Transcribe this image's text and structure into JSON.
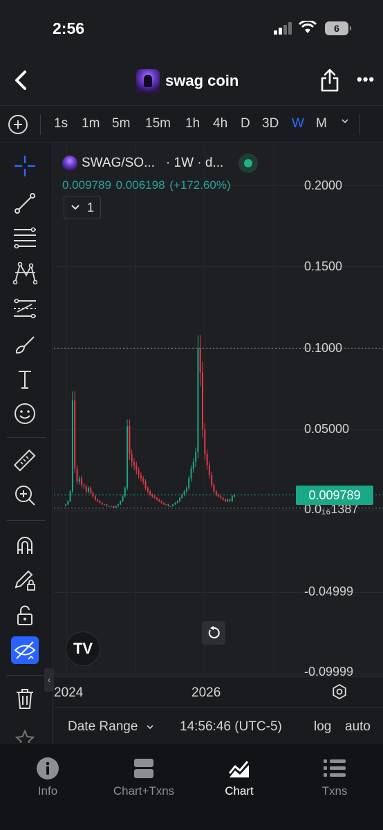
{
  "status_bar": {
    "time": "2:56",
    "battery": "6"
  },
  "header": {
    "title": "swag coin"
  },
  "timeframes": {
    "items": [
      "1s",
      "1m",
      "5m",
      "15m",
      "1h",
      "4h",
      "D",
      "3D",
      "W",
      "M"
    ],
    "selected": "W"
  },
  "chart": {
    "symbol": "SWAG/SO...",
    "interval": "· 1W · d...",
    "ohlc_text": "0.009789  0.006198 (+172.60%)",
    "collapse_count": "1",
    "price_labels": [
      "0.2000",
      "0.1500",
      "0.1000",
      "0.05000",
      "0.0₁₆1387",
      "-0.04999",
      "-0.09999"
    ],
    "last_price": "0.009789",
    "time_labels": [
      "2024",
      "2026"
    ],
    "logo_text": "TV"
  },
  "chart_data": {
    "type": "candlestick",
    "x": "weekly bars",
    "series": [
      {
        "values": [
          0.004,
          0.006,
          0.012,
          0.068,
          0.026,
          0.018,
          0.02,
          0.016,
          0.015,
          0.012,
          0.014,
          0.011,
          0.009,
          0.007,
          0.006,
          0.005,
          0.004,
          0.004,
          0.003,
          0.003,
          0.003,
          0.002,
          0.003,
          0.004,
          0.006,
          0.009,
          0.014,
          0.052,
          0.035,
          0.03,
          0.028,
          0.025,
          0.022,
          0.02,
          0.018,
          0.014,
          0.012,
          0.01,
          0.009,
          0.008,
          0.007,
          0.006,
          0.005,
          0.004,
          0.004,
          0.003,
          0.003,
          0.004,
          0.005,
          0.006,
          0.008,
          0.01,
          0.012,
          0.014,
          0.02,
          0.026,
          0.03,
          0.036,
          0.1,
          0.085,
          0.05,
          0.035,
          0.028,
          0.022,
          0.016,
          0.012,
          0.01,
          0.009,
          0.008,
          0.007,
          0.006,
          0.007,
          0.006,
          0.009,
          0.0098
        ]
      }
    ],
    "ylim": [
      -0.09999,
      0.2
    ]
  },
  "bottom_bar": {
    "date_range": "Date Range",
    "time": "14:56:46 (UTC-5)",
    "log": "log",
    "auto": "auto"
  },
  "tabs": [
    {
      "label": "Info",
      "icon": "info-icon"
    },
    {
      "label": "Chart+Txns",
      "icon": "split-panel-icon"
    },
    {
      "label": "Chart",
      "icon": "chart-icon"
    },
    {
      "label": "Txns",
      "icon": "list-icon"
    }
  ],
  "active_tab": "Chart",
  "colors": {
    "up": "#1aa886",
    "down": "#e53945",
    "accent": "#2962ff"
  }
}
